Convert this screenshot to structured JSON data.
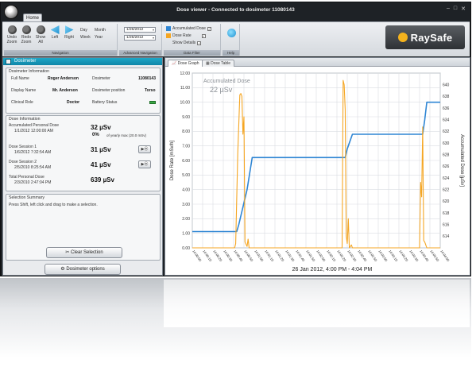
{
  "window": {
    "title": "Dose viewer - Connected to dosimeter 11080143",
    "controls": [
      "–",
      "□",
      "✕"
    ]
  },
  "ribbon": {
    "home_tab": "Home",
    "navigation": {
      "caption": "Navigation",
      "undo_zoom": "Undo Zoom",
      "redo_zoom": "Redo Zoom",
      "show_all": "Show All",
      "left": "Left",
      "right": "Right",
      "day": "Day",
      "month": "Month",
      "week": "Week",
      "year": "Year"
    },
    "advanced_navigation": {
      "caption": "Advanced Navigation",
      "date_from": "1/26/2012",
      "date_to": "1/26/2012"
    },
    "data_filter": {
      "caption": "Data Filter",
      "accumulated_dose": "Accumulated Dose",
      "dose_rate": "Dose Rate",
      "show_details": "Show Details",
      "check": "✓"
    },
    "help_caption": "Help",
    "logo_text": "RaySafe"
  },
  "colors": {
    "accumulated": "#2f86d4",
    "rate": "#f5a623",
    "header": "#1597b9",
    "logo_dot": "#f4b21d"
  },
  "dosimeter_panel": {
    "header": "Dosimeter",
    "info": {
      "title": "Dosimeter Information",
      "full_name_label": "Full Name",
      "full_name": "Roger Anderson",
      "dosimeter_label": "Dosimeter",
      "dosimeter_id": "11080143",
      "display_name_label": "Display Name",
      "display_name": "Mr. Anderson",
      "position_label": "Dosimeter position",
      "position": "Torso",
      "clinical_role_label": "Clinical Role",
      "clinical_role": "Doctor",
      "battery_label": "Battery Status"
    },
    "dose": {
      "title": "Dose Information",
      "accumulated_label": "Accumulated Personal Dose",
      "accumulated_date": "1/1/2012 12:00:00 AM",
      "accumulated_value": "32 µSv",
      "yearly_pct": "0%",
      "yearly_note": "of yearly max (20.0 mSv)",
      "session1_label": "Dose Session 1",
      "session1_date": "1/6/2012 7:32:54 AM",
      "session1_value": "31 µSv",
      "session2_label": "Dose Session 2",
      "session2_date": "2/5/2010 8:25:54 AM",
      "session2_value": "41 µSv",
      "total_label": "Total Personal Dose",
      "total_date": "2/3/2010 2:47:04 PM",
      "total_value": "639 µSv",
      "play_glyph": "▶⦿"
    },
    "selection": {
      "title": "Selection Summary",
      "hint": "Press Shift, left click and drag to make a selection.",
      "clear_button": "Clear Selection",
      "options_button": "Dosimeter options"
    }
  },
  "chart_tabs": {
    "graph": "Dose Graph",
    "table": "Dose Table"
  },
  "chart_data": {
    "type": "line",
    "title": "Accumulated Dose",
    "annotation": "22 µSv",
    "xlabel": "26 Jan 2012, 4:00 PM - 4:04 PM",
    "ylabel_left": "Dose Rate [mSv/h]",
    "ylabel_right": "Accumulated Dose [µSv]",
    "ylim_left": [
      0,
      12
    ],
    "ylim_right": [
      612,
      642
    ],
    "yticks_left": [
      "0.00",
      "1.00",
      "2.00",
      "3.00",
      "4.00",
      "5.00",
      "6.00",
      "7.00",
      "8.00",
      "9.00",
      "10.00",
      "11.00",
      "12.00"
    ],
    "yticks_right": [
      "614",
      "616",
      "618",
      "620",
      "622",
      "624",
      "626",
      "628",
      "630",
      "632",
      "634",
      "636",
      "638",
      "640"
    ],
    "xticks": [
      "16:00:00",
      "16:00:10",
      "16:00:20",
      "16:00:30",
      "16:00:40",
      "16:00:50",
      "16:01:00",
      "16:01:10",
      "16:01:20",
      "16:01:30",
      "16:01:40",
      "16:01:50",
      "16:02:00",
      "16:02:10",
      "16:02:20",
      "16:02:30",
      "16:02:40",
      "16:02:50",
      "16:03:00",
      "16:03:10",
      "16:03:20",
      "16:03:30",
      "16:03:40",
      "16:03:50",
      "16:04:00"
    ],
    "grid": true,
    "series": [
      {
        "name": "Accumulated Dose",
        "axis": "right",
        "x": [
          0,
          43,
          45,
          53,
          58,
          65,
          148,
          150,
          153,
          155,
          223,
          225,
          227,
          235,
          240
        ],
        "y": [
          614.8,
          614.8,
          616,
          622,
          627.5,
          627.5,
          627.5,
          629,
          630.5,
          631.5,
          631.5,
          634,
          637,
          637,
          637
        ]
      },
      {
        "name": "Dose Rate",
        "axis": "left",
        "x": [
          0,
          41,
          42,
          44,
          46,
          47,
          48,
          49,
          50,
          51,
          53,
          54,
          55,
          60,
          90,
          145,
          146,
          147,
          148,
          149,
          150,
          151,
          152,
          154,
          155,
          156,
          220,
          221,
          222,
          223,
          224,
          225,
          226,
          227,
          228,
          240
        ],
        "y": [
          0,
          0,
          0.3,
          6.5,
          10.5,
          10.6,
          10.4,
          7.8,
          9.0,
          0.4,
          0.1,
          0.6,
          0,
          0,
          0,
          0,
          11.5,
          11.2,
          9.5,
          0.8,
          0.3,
          2.0,
          0,
          0.2,
          0,
          0,
          0,
          4.5,
          3.5,
          8.3,
          0.5,
          0.4,
          0.2,
          0,
          0,
          0
        ]
      }
    ]
  }
}
